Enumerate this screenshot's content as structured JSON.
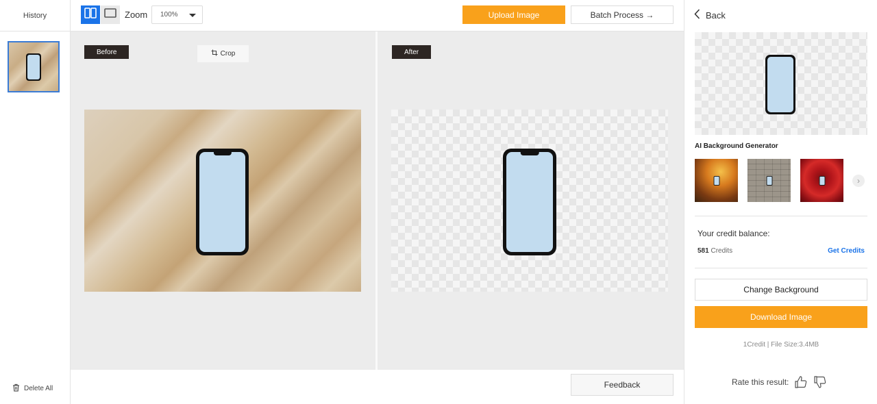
{
  "history": {
    "title": "History",
    "delete_all": "Delete All"
  },
  "toolbar": {
    "zoom_label": "Zoom",
    "zoom_value": "100%",
    "upload_label": "Upload Image",
    "batch_label": "Batch Process →"
  },
  "canvas": {
    "before_tag": "Before",
    "after_tag": "After",
    "crop_label": "Crop"
  },
  "bottom": {
    "feedback_label": "Feedback"
  },
  "panel": {
    "back_label": "Back",
    "ai_title": "AI Background Generator",
    "backgrounds": [
      {
        "name": "autumn-forest-background"
      },
      {
        "name": "stone-wall-background"
      },
      {
        "name": "red-rose-background"
      }
    ],
    "credit_label": "Your credit balance:",
    "credit_amount": "581",
    "credit_unit": "Credits",
    "get_credits": "Get Credits",
    "change_bg_label": "Change Background",
    "download_label": "Download Image",
    "file_info": "1Credit | File Size:3.4MB",
    "rate_label": "Rate this result:"
  },
  "colors": {
    "accent_orange": "#f9a11b",
    "accent_blue": "#1a73e8",
    "tag_dark": "#2d2623",
    "phone_screen": "#c2dcef"
  }
}
